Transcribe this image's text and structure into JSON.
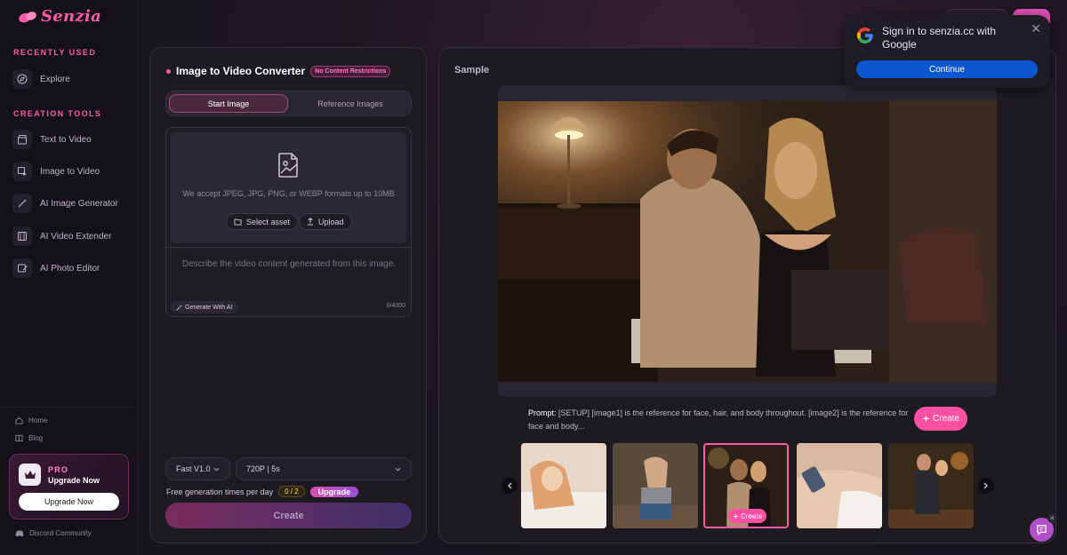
{
  "brand": {
    "name": "Senzia",
    "accent": "#ff5aa6"
  },
  "sidebar": {
    "recently_used_title": "RECENTLY USED",
    "recent_items": [
      {
        "label": "Explore",
        "icon": "compass-icon"
      }
    ],
    "creation_tools_title": "CREATION TOOLS",
    "tools": [
      {
        "label": "Text to Video",
        "icon": "clapperboard-icon"
      },
      {
        "label": "Image to Video",
        "icon": "image-video-icon"
      },
      {
        "label": "AI Image Generator",
        "icon": "magic-wand-icon"
      },
      {
        "label": "AI Video Extender",
        "icon": "film-icon"
      },
      {
        "label": "AI Photo Editor",
        "icon": "photo-edit-icon"
      }
    ],
    "bottom_links": [
      {
        "label": "Home",
        "icon": "home-icon"
      },
      {
        "label": "Blog",
        "icon": "book-icon"
      }
    ],
    "pro": {
      "badge": "PRO",
      "title": "Upgrade Now",
      "button": "Upgrade Now"
    },
    "discord": {
      "label": "Discord Community",
      "icon": "discord-icon"
    }
  },
  "converter": {
    "title": "Image to Video Converter",
    "tag": "No Content Restrictions",
    "tabs": [
      {
        "label": "Start Image",
        "active": true
      },
      {
        "label": "Reference Images",
        "active": false
      }
    ],
    "upload": {
      "hint": "We accept JPEG, JPG, PNG, or WEBP formats up to 10MB",
      "select_asset": "Select asset",
      "upload": "Upload"
    },
    "prompt": {
      "placeholder": "Describe the video content generated from this image.",
      "value": "",
      "counter": "0/4000"
    },
    "generate_ai": "Generate With AI",
    "model": "Fast V1.0",
    "quality": "720P | 5s",
    "free_label": "Free generation times per day",
    "free_count": "0 / 2",
    "upgrade": "Upgrade",
    "create": "Create"
  },
  "sample": {
    "label": "Sample",
    "prompt_label": "Prompt:",
    "prompt_text": " [SETUP] [image1] is the reference for face, hair, and body throughout. [image2] is the reference for face and body...",
    "create": "Create",
    "thumb_create": "Create",
    "thumbnails": [
      {
        "name": "thumbnail-1",
        "active": false
      },
      {
        "name": "thumbnail-2",
        "active": false
      },
      {
        "name": "thumbnail-3",
        "active": true
      },
      {
        "name": "thumbnail-4",
        "active": false
      },
      {
        "name": "thumbnail-5",
        "active": false
      }
    ]
  },
  "google_popup": {
    "text": "Sign in to senzia.cc with Google",
    "button": "Continue",
    "button_color": "#0b57d0"
  }
}
